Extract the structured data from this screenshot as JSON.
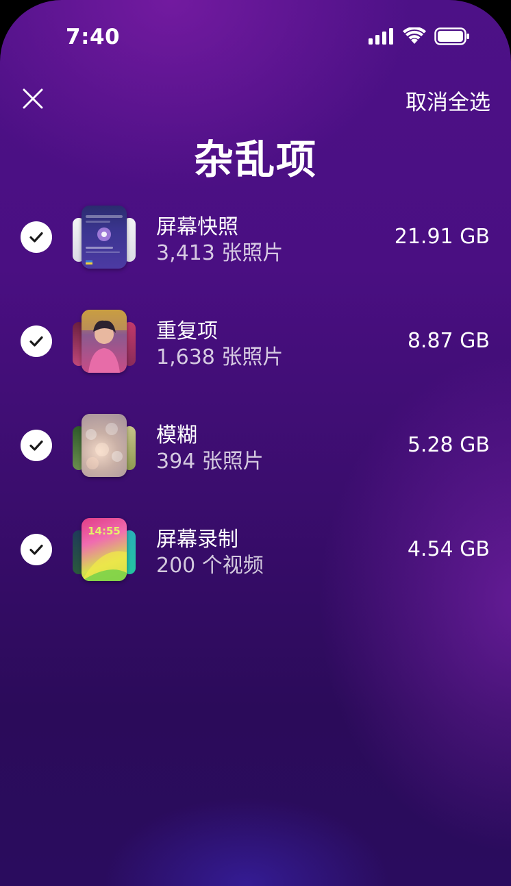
{
  "status_bar": {
    "time": "7:40",
    "icons": [
      "cellular-signal-icon",
      "wifi-icon",
      "battery-icon"
    ]
  },
  "nav": {
    "close_icon": "close-icon",
    "deselect_all": "取消全选"
  },
  "title": "杂乱项",
  "items": [
    {
      "title": "屏幕快照",
      "subtitle": "3,413 张照片",
      "size": "21.91 GB",
      "checked": true
    },
    {
      "title": "重复项",
      "subtitle": "1,638 张照片",
      "size": "8.87 GB",
      "checked": true
    },
    {
      "title": "模糊",
      "subtitle": "394 张照片",
      "size": "5.28 GB",
      "checked": true
    },
    {
      "title": "屏幕录制",
      "subtitle": "200 个视频",
      "size": "4.54 GB",
      "checked": true,
      "thumb_text": "14:55"
    }
  ],
  "colors": {
    "background_top": "#4d1187",
    "background_bottom": "#2a0c5e",
    "text": "#ffffff",
    "check_fill": "#ffffff",
    "check_mark": "#1a1a1a"
  }
}
